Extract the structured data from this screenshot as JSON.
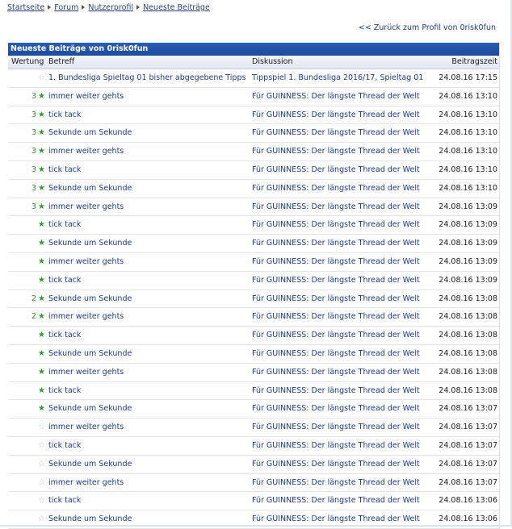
{
  "breadcrumb": [
    "Startseite",
    "Forum",
    "Nutzerprofil",
    "Neueste Beiträge"
  ],
  "back_link": "<< Zurück zum Profil von 0risk0fun",
  "panel_title": "Neueste Beiträge von 0risk0fun",
  "columns": {
    "rating": "Wertung",
    "subject": "Betreff",
    "discussion": "Diskussion",
    "time": "Beitragszeit"
  },
  "rows": [
    {
      "rating": "",
      "star": "empty",
      "subject": "1. Bundesliga Spieltag 01 bisher abgegebene Tipps",
      "discussion": "Tippspiel 1. Bundesliga 2016/17, Spieltag 01",
      "time": "24.08.16 17:15"
    },
    {
      "rating": "3",
      "star": "filled",
      "subject": "immer weiter gehts",
      "discussion": "Für GUINNESS: Der längste Thread der Welt",
      "time": "24.08.16 13:10"
    },
    {
      "rating": "3",
      "star": "filled",
      "subject": "tick tack",
      "discussion": "Für GUINNESS: Der längste Thread der Welt",
      "time": "24.08.16 13:10"
    },
    {
      "rating": "3",
      "star": "filled",
      "subject": "Sekunde um Sekunde",
      "discussion": "Für GUINNESS: Der längste Thread der Welt",
      "time": "24.08.16 13:10"
    },
    {
      "rating": "3",
      "star": "filled",
      "subject": "immer weiter gehts",
      "discussion": "Für GUINNESS: Der längste Thread der Welt",
      "time": "24.08.16 13:10"
    },
    {
      "rating": "3",
      "star": "filled",
      "subject": "tick tack",
      "discussion": "Für GUINNESS: Der längste Thread der Welt",
      "time": "24.08.16 13:10"
    },
    {
      "rating": "3",
      "star": "filled",
      "subject": "Sekunde um Sekunde",
      "discussion": "Für GUINNESS: Der längste Thread der Welt",
      "time": "24.08.16 13:10"
    },
    {
      "rating": "3",
      "star": "filled",
      "subject": "immer weiter gehts",
      "discussion": "Für GUINNESS: Der längste Thread der Welt",
      "time": "24.08.16 13:09"
    },
    {
      "rating": "",
      "star": "filled",
      "subject": "tick tack",
      "discussion": "Für GUINNESS: Der längste Thread der Welt",
      "time": "24.08.16 13:09"
    },
    {
      "rating": "",
      "star": "filled",
      "subject": "Sekunde um Sekunde",
      "discussion": "Für GUINNESS: Der längste Thread der Welt",
      "time": "24.08.16 13:09"
    },
    {
      "rating": "",
      "star": "filled",
      "subject": "immer weiter gehts",
      "discussion": "Für GUINNESS: Der längste Thread der Welt",
      "time": "24.08.16 13:09"
    },
    {
      "rating": "",
      "star": "filled",
      "subject": "tick tack",
      "discussion": "Für GUINNESS: Der längste Thread der Welt",
      "time": "24.08.16 13:09"
    },
    {
      "rating": "2",
      "star": "filled",
      "subject": "Sekunde um Sekunde",
      "discussion": "Für GUINNESS: Der längste Thread der Welt",
      "time": "24.08.16 13:08"
    },
    {
      "rating": "2",
      "star": "filled",
      "subject": "immer weiter gehts",
      "discussion": "Für GUINNESS: Der längste Thread der Welt",
      "time": "24.08.16 13:08"
    },
    {
      "rating": "",
      "star": "filled",
      "subject": "tick tack",
      "discussion": "Für GUINNESS: Der längste Thread der Welt",
      "time": "24.08.16 13:08"
    },
    {
      "rating": "",
      "star": "filled",
      "subject": "Sekunde um Sekunde",
      "discussion": "Für GUINNESS: Der längste Thread der Welt",
      "time": "24.08.16 13:08"
    },
    {
      "rating": "",
      "star": "filled",
      "subject": "immer weiter gehts",
      "discussion": "Für GUINNESS: Der längste Thread der Welt",
      "time": "24.08.16 13:08"
    },
    {
      "rating": "",
      "star": "filled",
      "subject": "tick tack",
      "discussion": "Für GUINNESS: Der längste Thread der Welt",
      "time": "24.08.16 13:08"
    },
    {
      "rating": "",
      "star": "filled",
      "subject": "Sekunde um Sekunde",
      "discussion": "Für GUINNESS: Der längste Thread der Welt",
      "time": "24.08.16 13:07"
    },
    {
      "rating": "",
      "star": "empty",
      "subject": "immer weiter gehts",
      "discussion": "Für GUINNESS: Der längste Thread der Welt",
      "time": "24.08.16 13:07"
    },
    {
      "rating": "",
      "star": "empty",
      "subject": "tick tack",
      "discussion": "Für GUINNESS: Der längste Thread der Welt",
      "time": "24.08.16 13:07"
    },
    {
      "rating": "",
      "star": "empty",
      "subject": "Sekunde um Sekunde",
      "discussion": "Für GUINNESS: Der längste Thread der Welt",
      "time": "24.08.16 13:07"
    },
    {
      "rating": "",
      "star": "empty",
      "subject": "immer weiter gehts",
      "discussion": "Für GUINNESS: Der längste Thread der Welt",
      "time": "24.08.16 13:07"
    },
    {
      "rating": "",
      "star": "empty",
      "subject": "tick tack",
      "discussion": "Für GUINNESS: Der längste Thread der Welt",
      "time": "24.08.16 13:06"
    },
    {
      "rating": "",
      "star": "empty",
      "subject": "Sekunde um Sekunde",
      "discussion": "Für GUINNESS: Der längste Thread der Welt",
      "time": "24.08.16 13:06"
    }
  ]
}
